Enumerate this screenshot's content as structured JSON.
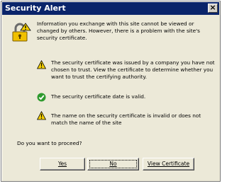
{
  "window": {
    "title": "Security Alert",
    "close_label": "×"
  },
  "intro_text": "Information you exchange with this site cannot be viewed or changed by others. However, there is a problem with the site's security certificate.",
  "checks": [
    {
      "icon": "warning-icon",
      "text": "The security certificate was issued by a company you have not chosen to trust. View the certificate to determine whether you want to trust the certifying authority."
    },
    {
      "icon": "check-icon",
      "text": "The security certificate date is valid."
    },
    {
      "icon": "warning-icon",
      "text": "The name on the security certificate is invalid or does not match the name of the site"
    }
  ],
  "prompt": "Do you want to proceed?",
  "buttons": {
    "yes": "Yes",
    "no": "No",
    "view": "View Certificate"
  },
  "colors": {
    "titlebar": "#0a246a",
    "dialog_bg": "#ece9d8",
    "warning": "#f5d000",
    "ok": "#2e9a2e"
  }
}
